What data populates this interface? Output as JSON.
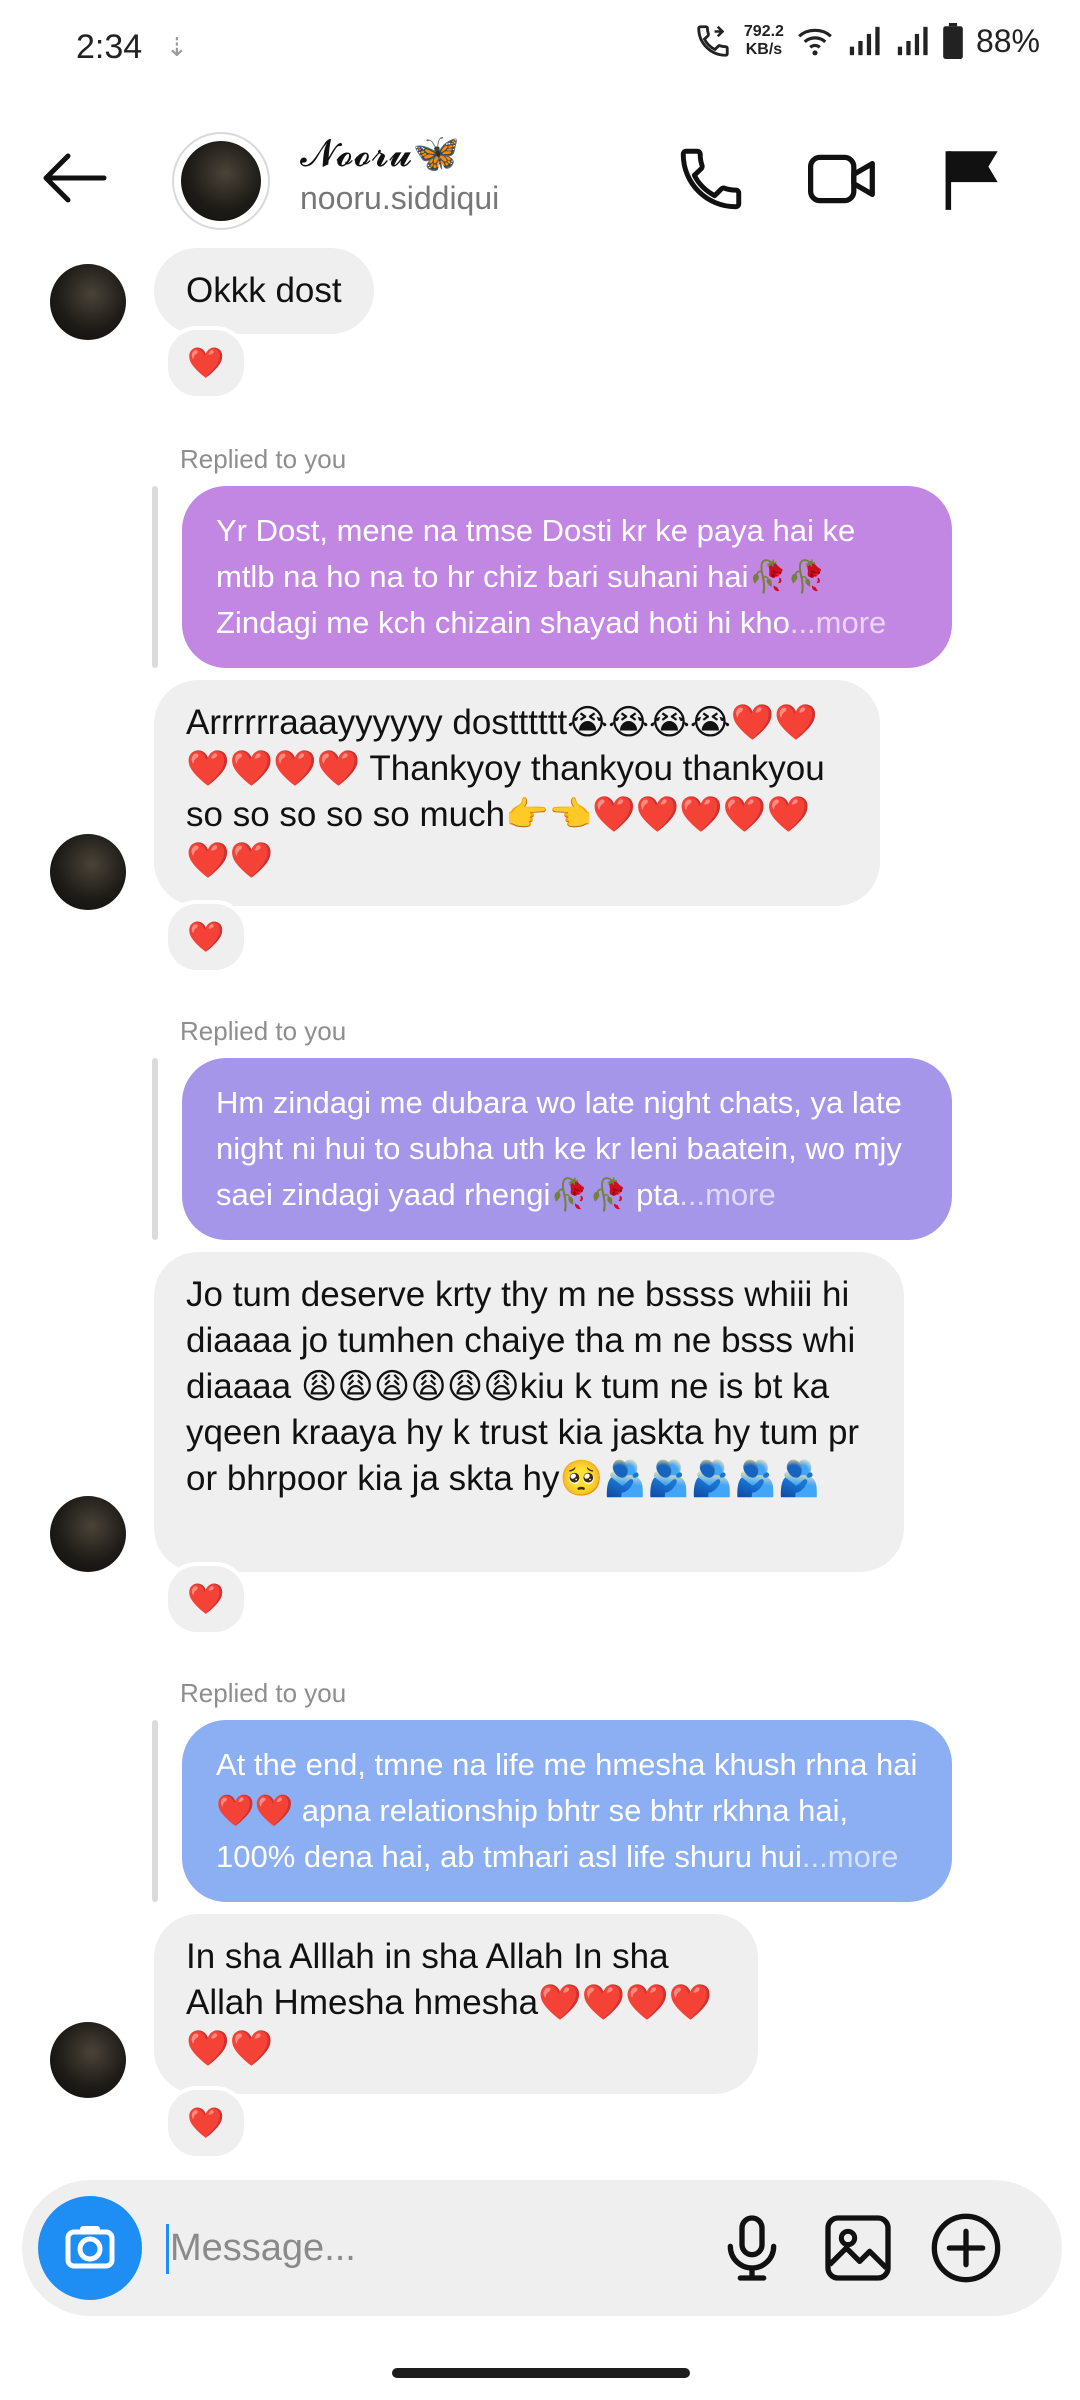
{
  "status_bar": {
    "time": "2:34",
    "download_glyph": "⇣",
    "net_speed_value": "792.2",
    "net_speed_unit": "KB/s",
    "battery": "88%"
  },
  "header": {
    "display_name": "𝓝𝓸𝓸𝓻𝓾",
    "butterfly": "🦋",
    "username": "nooru.siddiqui"
  },
  "messages": [
    {
      "text": "Okkk dost",
      "reaction": "❤️"
    },
    {
      "replied_label": "Replied to you",
      "reply_text": "Yr Dost, mene na tmse Dosti kr ke paya hai ke mtlb na ho na to hr chiz bari suhani hai🥀🥀 Zindagi me kch chizain shayad hoti hi kho",
      "more": "...more",
      "color": "#c286e3"
    },
    {
      "text": "Arrrrrraaayyyyyy dostttttt😭😭😭😭❤️❤️❤️❤️❤️❤️ Thankyoy thankyou thankyou so so so so so much👉👈❤️❤️❤️❤️❤️❤️❤️",
      "reaction": "❤️"
    },
    {
      "replied_label": "Replied to you",
      "reply_text": "Hm zindagi me dubara wo late night chats, ya late night ni hui to subha uth ke kr leni baatein, wo mjy saei zindagi yaad rhengi🥀🥀 pta",
      "more": "...more",
      "color": "#a596ea"
    },
    {
      "text": "Jo tum deserve krty thy m ne bssss whiii hi diaaaa jo tumhen chaiye tha m ne bsss whi diaaaa 😩😩😩😩😩😩kiu k tum ne is bt ka yqeen kraaya hy k trust kia jaskta hy tum pr or bhrpoor kia ja skta hy🥺🫂🫂🫂🫂🫂",
      "reaction": "❤️"
    },
    {
      "replied_label": "Replied to you",
      "reply_text": "At the end, tmne na life me hmesha khush rhna hai❤️❤️ apna relationship bhtr se bhtr rkhna hai, 100% dena hai, ab tmhari asl life shuru hui",
      "more": "...more",
      "color": "#8caef2"
    },
    {
      "text": "In sha Alllah in sha Allah In sha Allah Hmesha hmesha❤️❤️❤️❤️❤️❤️",
      "reaction": "❤️"
    }
  ],
  "composer": {
    "placeholder": "Message..."
  }
}
